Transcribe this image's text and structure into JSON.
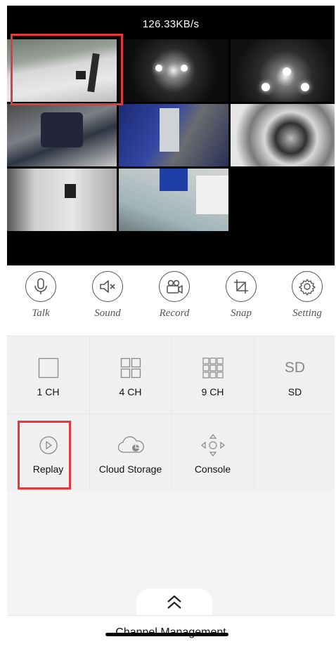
{
  "stream": {
    "speed": "126.33KB/s"
  },
  "toolbar": {
    "items": [
      {
        "label": "Talk"
      },
      {
        "label": "Sound"
      },
      {
        "label": "Record"
      },
      {
        "label": "Snap"
      },
      {
        "label": "Setting"
      }
    ]
  },
  "functions": {
    "items": [
      {
        "label": "1 CH"
      },
      {
        "label": "4 CH"
      },
      {
        "label": "9 CH"
      },
      {
        "label": "SD",
        "icon_text": "SD"
      },
      {
        "label": "Replay"
      },
      {
        "label": "Cloud Storage"
      },
      {
        "label": "Console"
      }
    ]
  },
  "bottom": {
    "label": "Channel Management"
  },
  "colors": {
    "highlight": "#e0393e",
    "video_bg": "#000000",
    "panel_bg": "#f0f0f0"
  }
}
